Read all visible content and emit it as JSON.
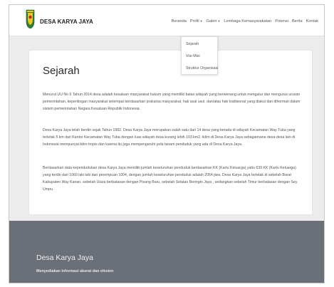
{
  "brand": {
    "name": "DESA KARYA JAYA"
  },
  "nav": {
    "beranda": "Beranda",
    "profil": "Profil",
    "galeri": "Galeri",
    "lembaga": "Lembaga Kemasyarakatan",
    "potensi": "Potensi",
    "berita": "Berita",
    "kontak": "Kontak"
  },
  "dropdown": [
    "Sejarah",
    "Visi-Misi",
    "Struktur Organisasi"
  ],
  "main": {
    "title": "Sejarah",
    "paragraphs": [
      "Menurut UU No 6 Tahun 2014 desa adalah kesatuan masyarakat hukum yang memiliki batas wilayah yang berwenang untuk mengatur dan mengurus urusan pemerintahan, kepentingan masyarakat setempat berdasarkan prakarsa masyarakat, hak asal usul, dan/atau hak tradisional yang diakui dan dihormati dalam sistem pemerintahan Negara Kesatuan Republik Indonesia.",
      "Desa Karya Jaya telah berdiri sejak Tahun 1982. Desa Karya Jaya merupakan salah satu dari 14 desa yang berada di wilayah Kecamatan Way Tuba yang terletak 5 km dari Kantor Kecamatan Way Tuba dengan luas wilayah desa kurang lebih 103 km2. Iklim di Desa Karya Jaya sebagaimana desa-desa lain di Indonesia mempunyai iklim tropis dan karena itu juga mempengaruhi pola tanam penduduk yang ada di Desa Karya Jaya.",
      "Berdasarkan data kependudukan desa Karya Jaya memiliki jumlah keseluruhan penduduk berdasarkan KK (Kartu Keluarga) yaitu 639 KK (Kartu Keluarga) yang terdiri dari 1060 laki laki dan perempuan 1004, dengan jumlah keseluruhan penduduk adalah 2064 jiwa. Desa Karya Jaya terletak di sebelah Barat Kabupaten Way Kanan. sebelah Utara berbatasan dengan Pisang Baru, sebelah Selatan Beringin Jaya , sedangkan sebelah Timur berbatasan dengan Sey Umpu."
    ]
  },
  "footer": {
    "title": "Desa Karya Jaya",
    "subtitle": "Menyediakan Informasi akurat dan efesien"
  },
  "colors": {
    "footer_bg": "#6a6f78",
    "logo_green": "#2e7d32",
    "logo_yellow": "#f2c318"
  },
  "icons": {
    "logo": "village-crest-icon"
  }
}
